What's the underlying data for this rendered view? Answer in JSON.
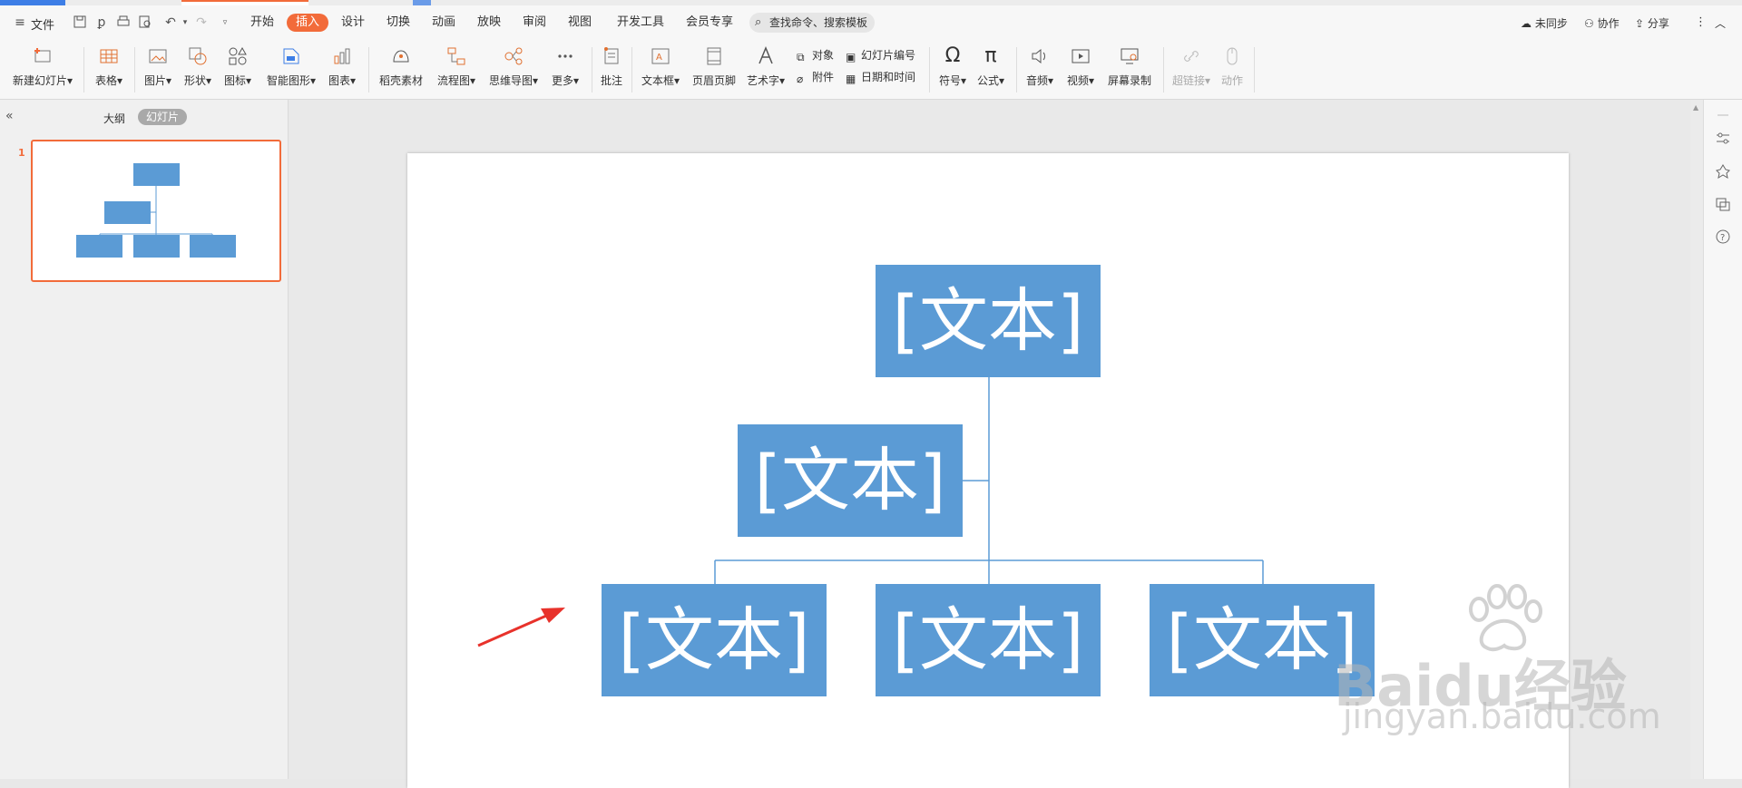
{
  "menubar": {
    "file": "文件",
    "tabs": [
      "开始",
      "插入",
      "设计",
      "切换",
      "动画",
      "放映",
      "审阅",
      "视图",
      "开发工具",
      "会员专享"
    ],
    "active_tab": "插入",
    "search_placeholder": "查找命令、搜索模板",
    "right": {
      "sync": "未同步",
      "collab": "协作",
      "share": "分享"
    }
  },
  "ribbon": {
    "new_slide": "新建幻灯片",
    "table": "表格",
    "picture": "图片",
    "shape": "形状",
    "icon": "图标",
    "smartart": "智能图形",
    "chart": "图表",
    "docer": "稻壳素材",
    "flowchart": "流程图",
    "mindmap": "思维导图",
    "more": "更多",
    "comment": "批注",
    "textbox": "文本框",
    "header_footer": "页眉页脚",
    "wordart": "艺术字",
    "object": "对象",
    "slide_number": "幻灯片编号",
    "attachment": "附件",
    "datetime": "日期和时间",
    "symbol": "符号",
    "formula": "公式",
    "audio": "音频",
    "video": "视频",
    "screen_record": "屏幕录制",
    "hyperlink": "超链接",
    "action": "动作"
  },
  "leftpanel": {
    "outline_tab": "大纲",
    "slides_tab": "幻灯片",
    "slide_number": "1"
  },
  "slide": {
    "nodes": [
      "[文本]",
      "[文本]",
      "[文本]",
      "[文本]",
      "[文本]"
    ],
    "node_color": "#5b9bd5",
    "line_color": "#5b9bd5",
    "arrow_color": "#e8322b"
  },
  "accent": "#f26b3a",
  "watermark": {
    "logo": "Baidu经验",
    "url": "jingyan.baidu.com"
  }
}
